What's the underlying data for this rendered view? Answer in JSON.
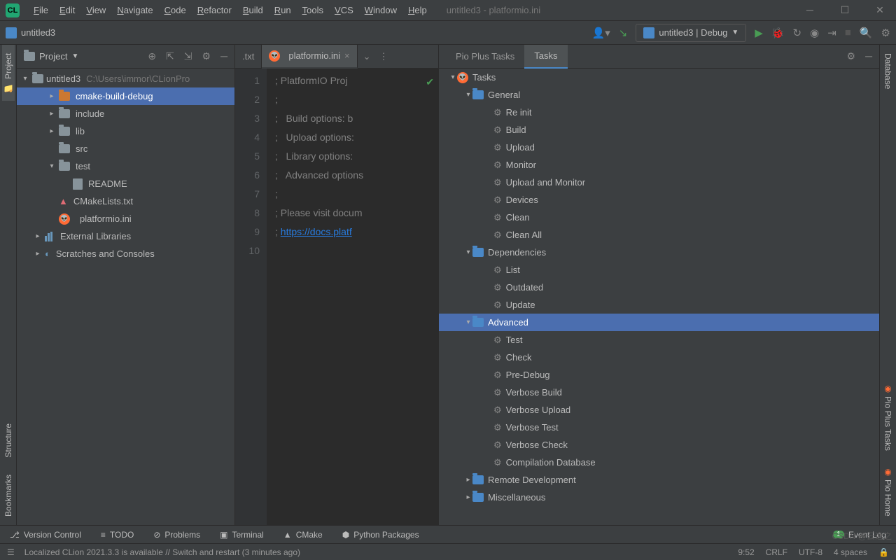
{
  "window": {
    "title": "untitled3 - platformio.ini"
  },
  "menu": [
    "File",
    "Edit",
    "View",
    "Navigate",
    "Code",
    "Refactor",
    "Build",
    "Run",
    "Tools",
    "VCS",
    "Window",
    "Help"
  ],
  "breadcrumb": "untitled3",
  "run_config": "untitled3 | Debug",
  "project_panel": {
    "title": "Project",
    "root": "untitled3",
    "root_path": "C:\\Users\\immor\\CLionPro",
    "tree": [
      {
        "label": "cmake-build-debug",
        "icon": "folder-orange",
        "indent": 1,
        "arrow": "right",
        "selected": true
      },
      {
        "label": "include",
        "icon": "folder",
        "indent": 1,
        "arrow": "right"
      },
      {
        "label": "lib",
        "icon": "folder",
        "indent": 1,
        "arrow": "right"
      },
      {
        "label": "src",
        "icon": "folder",
        "indent": 1
      },
      {
        "label": "test",
        "icon": "folder",
        "indent": 1,
        "arrow": "down"
      },
      {
        "label": "README",
        "icon": "file",
        "indent": 2
      },
      {
        "label": "CMakeLists.txt",
        "icon": "cmake",
        "indent": 1
      },
      {
        "label": "platformio.ini",
        "icon": "pio",
        "indent": 1
      },
      {
        "label": "External Libraries",
        "icon": "libs",
        "indent": 0,
        "arrow": "right"
      },
      {
        "label": "Scratches and Consoles",
        "icon": "scratch",
        "indent": 0,
        "arrow": "right"
      }
    ]
  },
  "editor": {
    "tabs": [
      {
        "label": ".txt",
        "active": false
      },
      {
        "label": "platformio.ini",
        "active": true,
        "icon": "pio"
      }
    ],
    "lines": [
      "; PlatformIO Proj",
      ";",
      ";   Build options: b",
      ";   Upload options: ",
      ";   Library options:",
      ";   Advanced options",
      ";",
      "; Please visit docum",
      "; "
    ],
    "link_line": "https://docs.platf"
  },
  "tasks": {
    "tabs": [
      "Pio Plus Tasks",
      "Tasks"
    ],
    "active_tab": 1,
    "root": "Tasks",
    "groups": [
      {
        "label": "General",
        "expanded": true,
        "items": [
          "Re init",
          "Build",
          "Upload",
          "Monitor",
          "Upload and Monitor",
          "Devices",
          "Clean",
          "Clean All"
        ]
      },
      {
        "label": "Dependencies",
        "expanded": true,
        "items": [
          "List",
          "Outdated",
          "Update"
        ]
      },
      {
        "label": "Advanced",
        "expanded": true,
        "selected": true,
        "items": [
          "Test",
          "Check",
          "Pre-Debug",
          "Verbose Build",
          "Verbose Upload",
          "Verbose Test",
          "Verbose Check",
          "Compilation Database"
        ]
      },
      {
        "label": "Remote Development",
        "expanded": false,
        "items": []
      },
      {
        "label": "Miscellaneous",
        "expanded": false,
        "items": []
      }
    ]
  },
  "left_tabs": [
    "Project",
    "Structure",
    "Bookmarks"
  ],
  "right_tabs": [
    "Database",
    "Pio Plus Tasks",
    "Pio Home"
  ],
  "statusbar1": [
    "Version Control",
    "TODO",
    "Problems",
    "Terminal",
    "CMake",
    "Python Packages"
  ],
  "statusbar2": {
    "msg": "Localized CLion 2021.3.3 is available // Switch and restart (3 minutes ago)",
    "event": "Event Log",
    "event_count": "1",
    "time": "9:52",
    "eol": "CRLF",
    "enc": "UTF-8",
    "indent": "4 spaces",
    "watermark": "CSDN @云逸之"
  }
}
